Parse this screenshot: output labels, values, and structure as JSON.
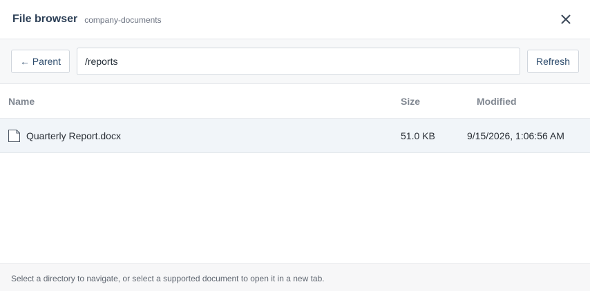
{
  "header": {
    "title": "File browser",
    "subtitle": "company-documents",
    "close_icon": "close-icon"
  },
  "toolbar": {
    "parent_label": "← Parent",
    "path_value": "/reports",
    "refresh_label": "Refresh"
  },
  "table": {
    "columns": [
      "Name",
      "Size",
      "Modified"
    ],
    "rows": [
      {
        "icon": "file-icon",
        "name": "Quarterly Report.docx",
        "size": "51.0 KB",
        "modified": "9/15/2026, 1:06:56 AM"
      }
    ]
  },
  "footer": {
    "hint": "Select a directory to navigate, or select a supported document to open it in a new tab."
  },
  "colors": {
    "title": "#2b3e55",
    "row_highlight": "#f1f5f9",
    "button_text": "#2b4a6b"
  }
}
